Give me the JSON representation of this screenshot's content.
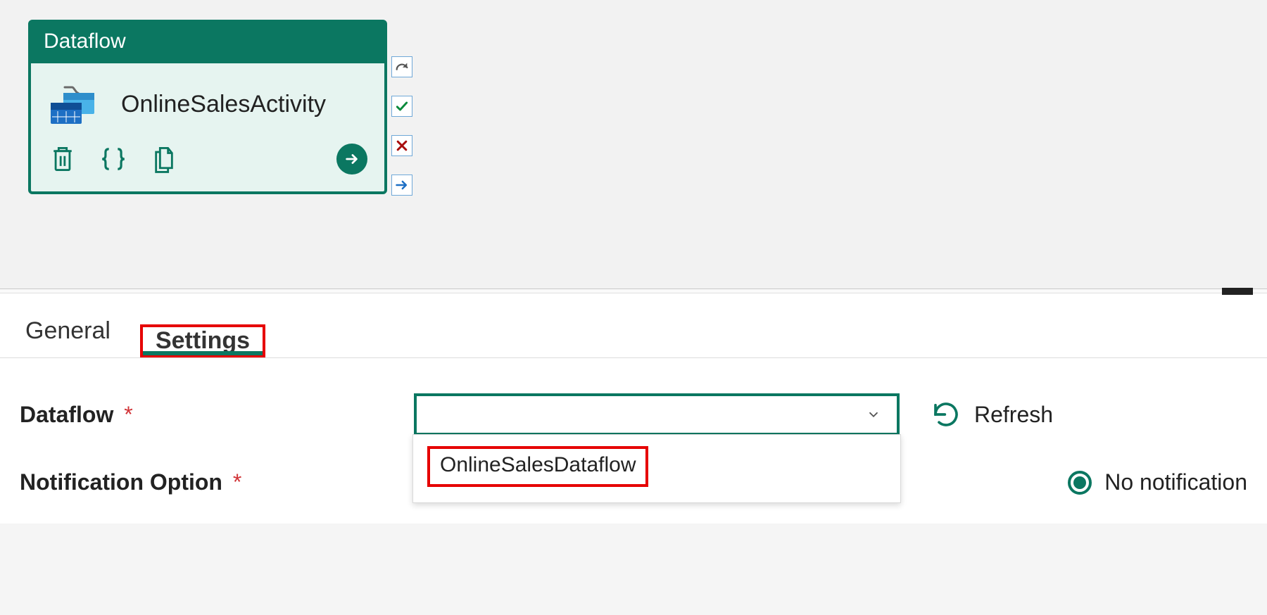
{
  "activity": {
    "type_label": "Dataflow",
    "name": "OnlineSalesActivity"
  },
  "side_actions": {
    "redo": "redo-icon",
    "success": "check-icon",
    "fail": "x-icon",
    "next": "arrow-right-icon"
  },
  "tabs": {
    "general": "General",
    "settings": "Settings"
  },
  "settings": {
    "dataflow": {
      "label": "Dataflow",
      "required": "*",
      "selected_value": "",
      "options": [
        "OnlineSalesDataflow"
      ]
    },
    "refresh_label": "Refresh",
    "notification": {
      "label": "Notification Option",
      "required": "*",
      "selected": "No notification"
    }
  }
}
